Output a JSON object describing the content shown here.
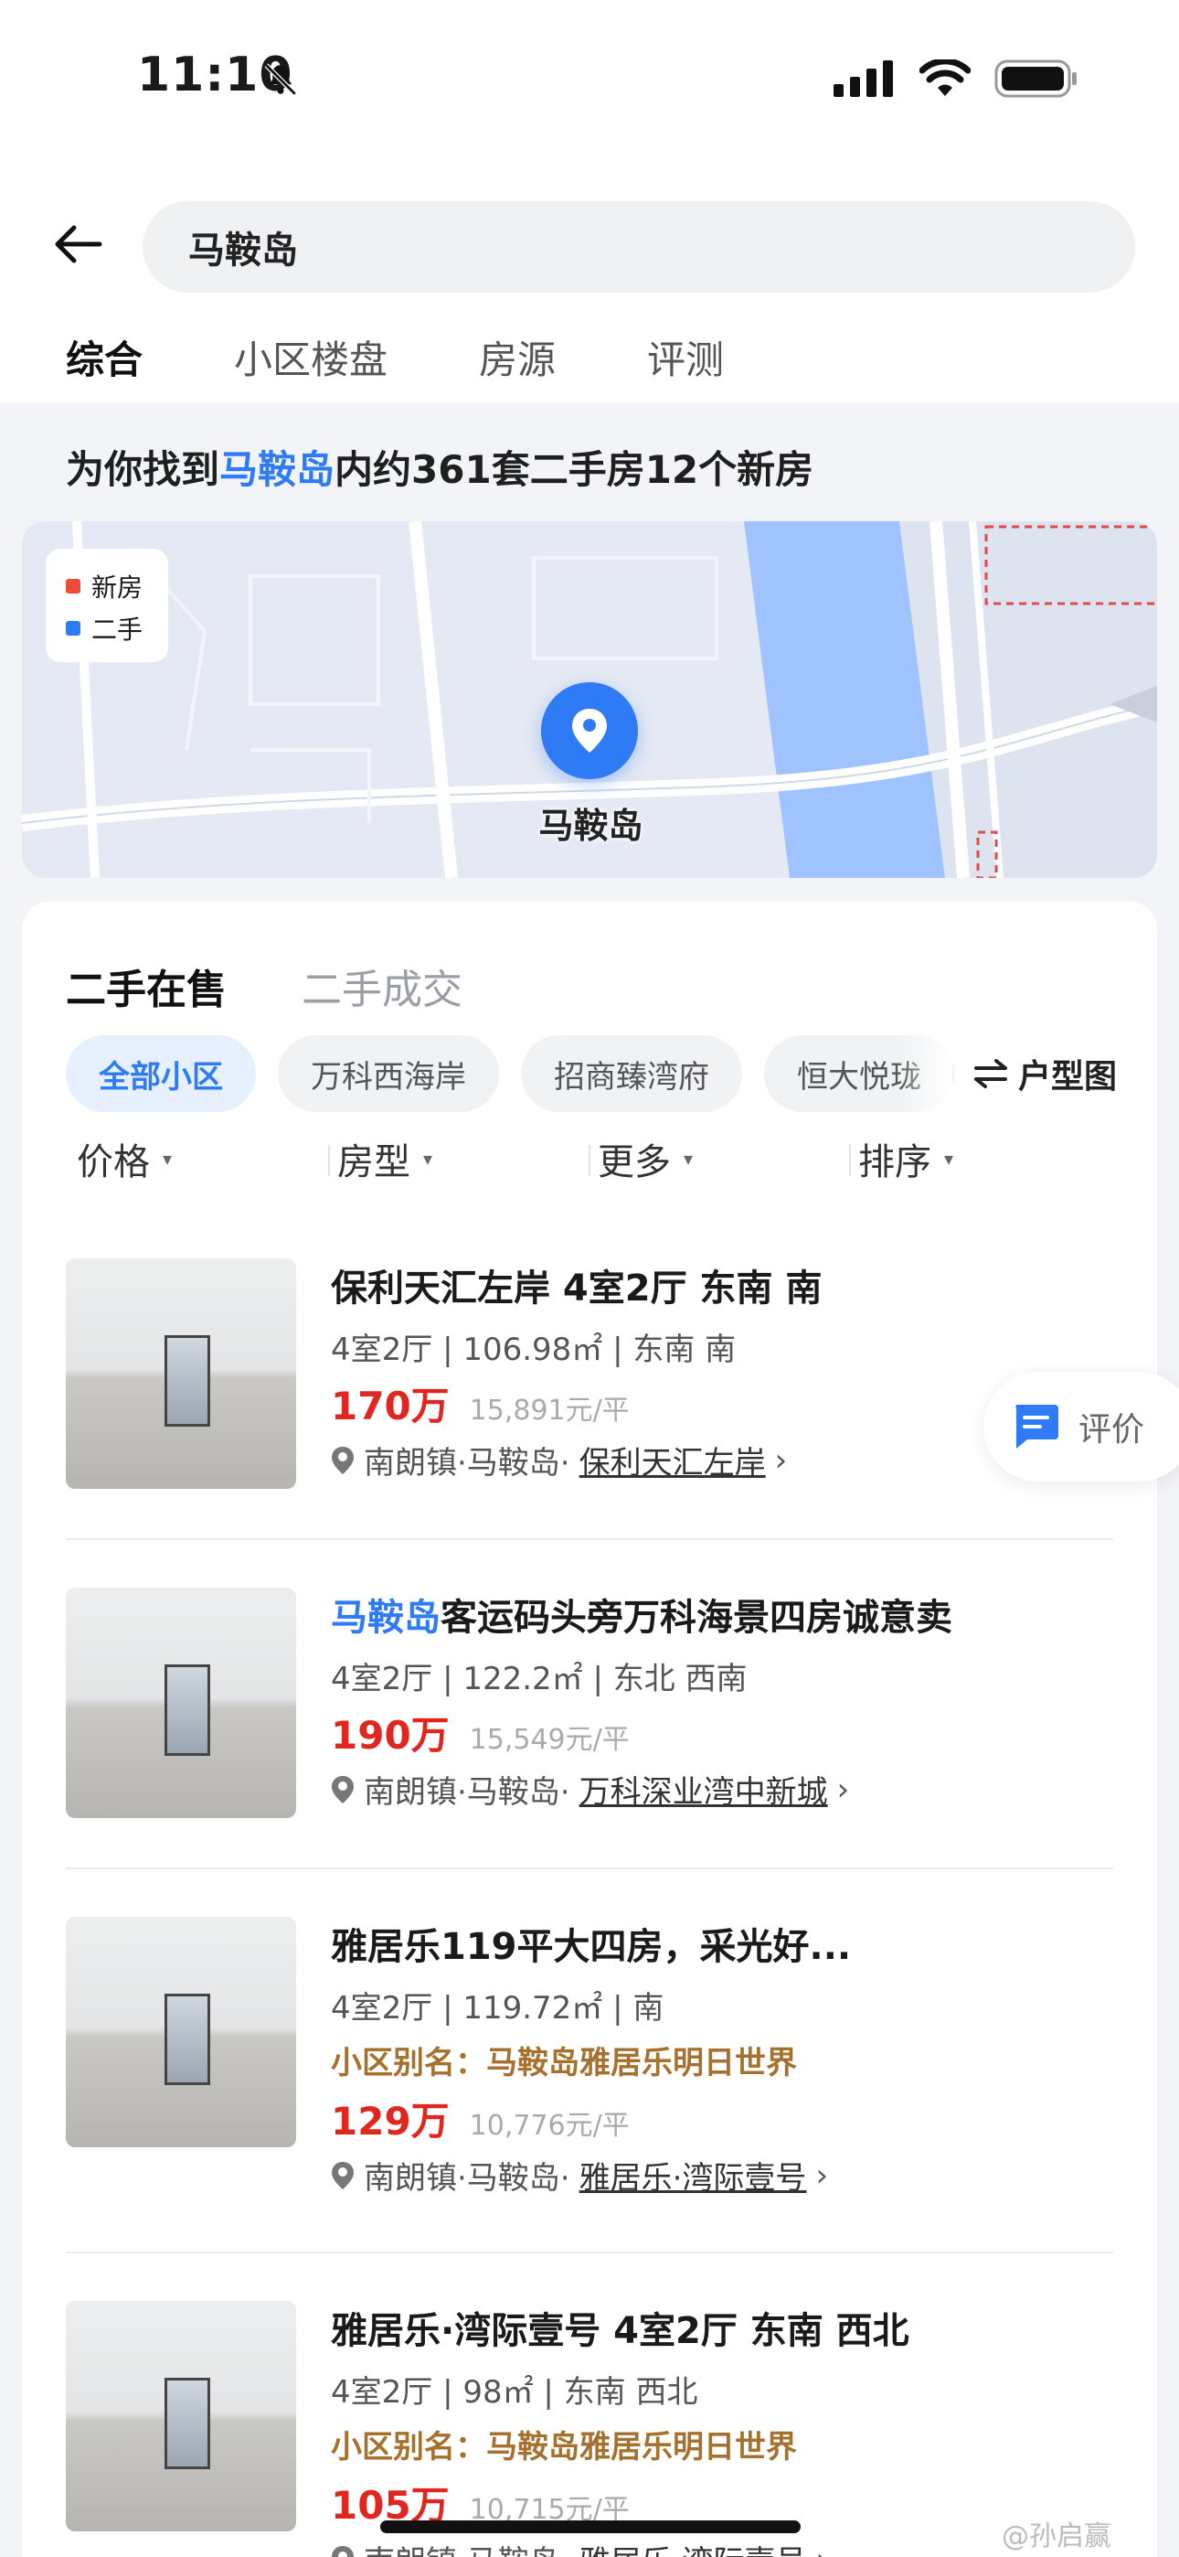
{
  "status_bar": {
    "time": "11:10"
  },
  "search": {
    "query": "马鞍岛"
  },
  "tabs": [
    {
      "label": "综合",
      "active": true
    },
    {
      "label": "小区楼盘",
      "active": false
    },
    {
      "label": "房源",
      "active": false
    },
    {
      "label": "评测",
      "active": false
    }
  ],
  "summary": {
    "prefix": "为你找到",
    "highlight": "马鞍岛",
    "suffix": "内约361套二手房12个新房"
  },
  "map": {
    "legend": [
      {
        "label": "新房",
        "color": "#f04a3a"
      },
      {
        "label": "二手",
        "color": "#2f7bf5"
      }
    ],
    "pin_label": "马鞍岛"
  },
  "listing_tabs": [
    {
      "label": "二手在售",
      "active": true
    },
    {
      "label": "二手成交",
      "active": false
    }
  ],
  "chips": [
    {
      "label": "全部小区",
      "active": true
    },
    {
      "label": "万科西海岸",
      "active": false
    },
    {
      "label": "招商臻湾府",
      "active": false
    },
    {
      "label": "恒大悦珑",
      "active": false
    }
  ],
  "floor_plan_button": "户型图",
  "filters": [
    "价格",
    "房型",
    "更多",
    "排序"
  ],
  "listings": [
    {
      "title": "保利天汇左岸 4室2厅 东南 南",
      "title_highlight": "",
      "specs": "4室2厅 | 106.98㎡ | 东南 南",
      "alias": "",
      "price": "170万",
      "unit_price": "15,891元/平",
      "location_prefix": "南朗镇·马鞍岛·",
      "community": "保利天汇左岸"
    },
    {
      "title": "客运码头旁万科海景四房诚意卖",
      "title_highlight": "马鞍岛",
      "specs": "4室2厅 | 122.2㎡ | 东北 西南",
      "alias": "",
      "price": "190万",
      "unit_price": "15,549元/平",
      "location_prefix": "南朗镇·马鞍岛·",
      "community": "万科深业湾中新城"
    },
    {
      "title": "雅居乐119平大四房，采光好...",
      "title_highlight": "",
      "specs": "4室2厅 | 119.72㎡ | 南",
      "alias": "小区别名：马鞍岛雅居乐明日世界",
      "price": "129万",
      "unit_price": "10,776元/平",
      "location_prefix": "南朗镇·马鞍岛·",
      "community": "雅居乐·湾际壹号"
    },
    {
      "title": "雅居乐·湾际壹号 4室2厅 东南 西北",
      "title_highlight": "",
      "specs": "4室2厅 | 98㎡ | 东南 西北",
      "alias": "小区别名：马鞍岛雅居乐明日世界",
      "price": "105万",
      "unit_price": "10,715元/平",
      "location_prefix": "南朗镇·马鞍岛·",
      "community": "雅居乐·湾际壹号"
    }
  ],
  "float_button": {
    "label": "评价"
  },
  "watermark": "@孙启赢",
  "icons": {
    "back": "back-arrow-icon",
    "pin": "location-pin-icon",
    "swap": "swap-icon",
    "location": "location-icon",
    "chat": "chat-icon"
  }
}
